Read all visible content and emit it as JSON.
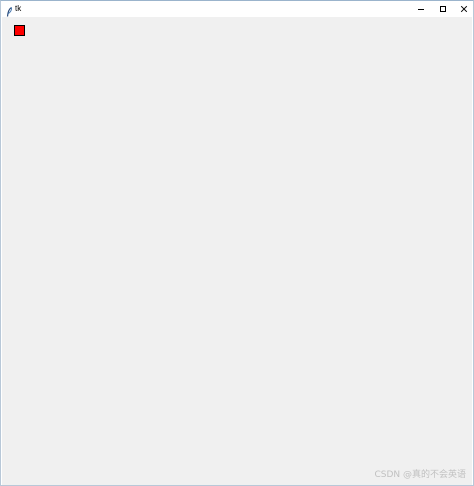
{
  "window": {
    "title": "tk",
    "controls": {
      "minimize_icon": "minimize-icon",
      "maximize_icon": "maximize-icon",
      "close_icon": "close-icon"
    }
  },
  "canvas": {
    "background": "#f0f0f0",
    "shapes": [
      {
        "type": "rectangle",
        "fill": "#ff0000",
        "outline": "#000000"
      }
    ]
  },
  "watermark": "CSDN @真的不会英语"
}
